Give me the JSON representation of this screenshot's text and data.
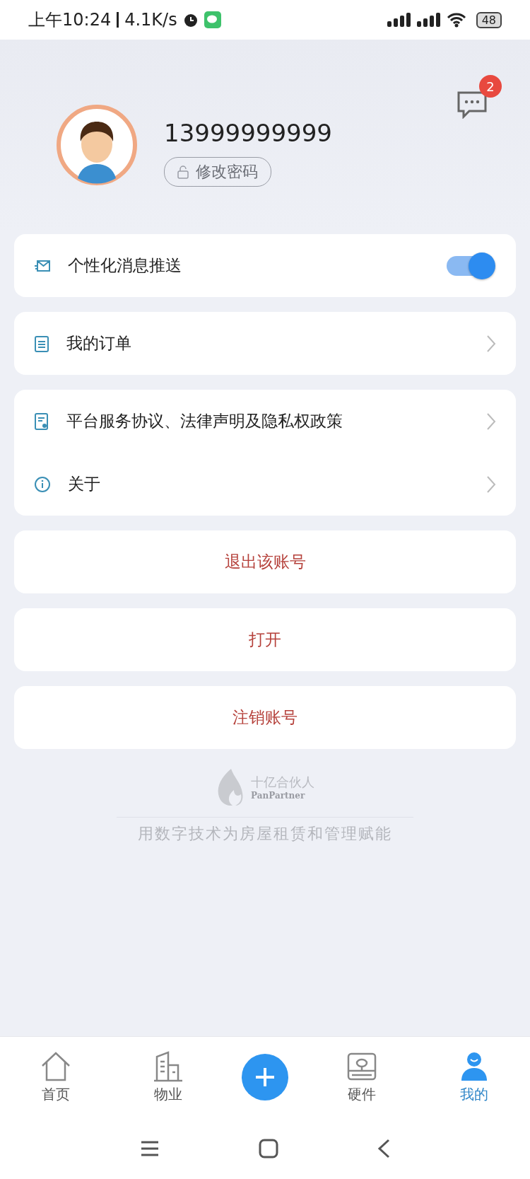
{
  "status_bar": {
    "time": "上午10:24",
    "speed": "4.1K/s",
    "battery": "48"
  },
  "profile": {
    "phone": "13999999999",
    "change_password": "修改密码",
    "message_count": "2"
  },
  "settings": [
    {
      "kind": "toggle",
      "label": "个性化消息推送",
      "on": true
    }
  ],
  "menu_groups": [
    [
      {
        "label": "我的订单"
      }
    ],
    [
      {
        "label": "平台服务协议、法律声明及隐私权政策"
      },
      {
        "label": "关于"
      }
    ]
  ],
  "actions": [
    "退出该账号",
    "打开",
    "注销账号"
  ],
  "brand": {
    "name": "十亿合伙人",
    "name_en": "PanPartner",
    "slogan": "用数字技术为房屋租赁和管理赋能"
  },
  "tabs": [
    {
      "label": "首页",
      "selected": false
    },
    {
      "label": "物业",
      "selected": false
    },
    {
      "selected": false
    },
    {
      "label": "硬件",
      "selected": false
    },
    {
      "label": "我的",
      "selected": true
    }
  ]
}
